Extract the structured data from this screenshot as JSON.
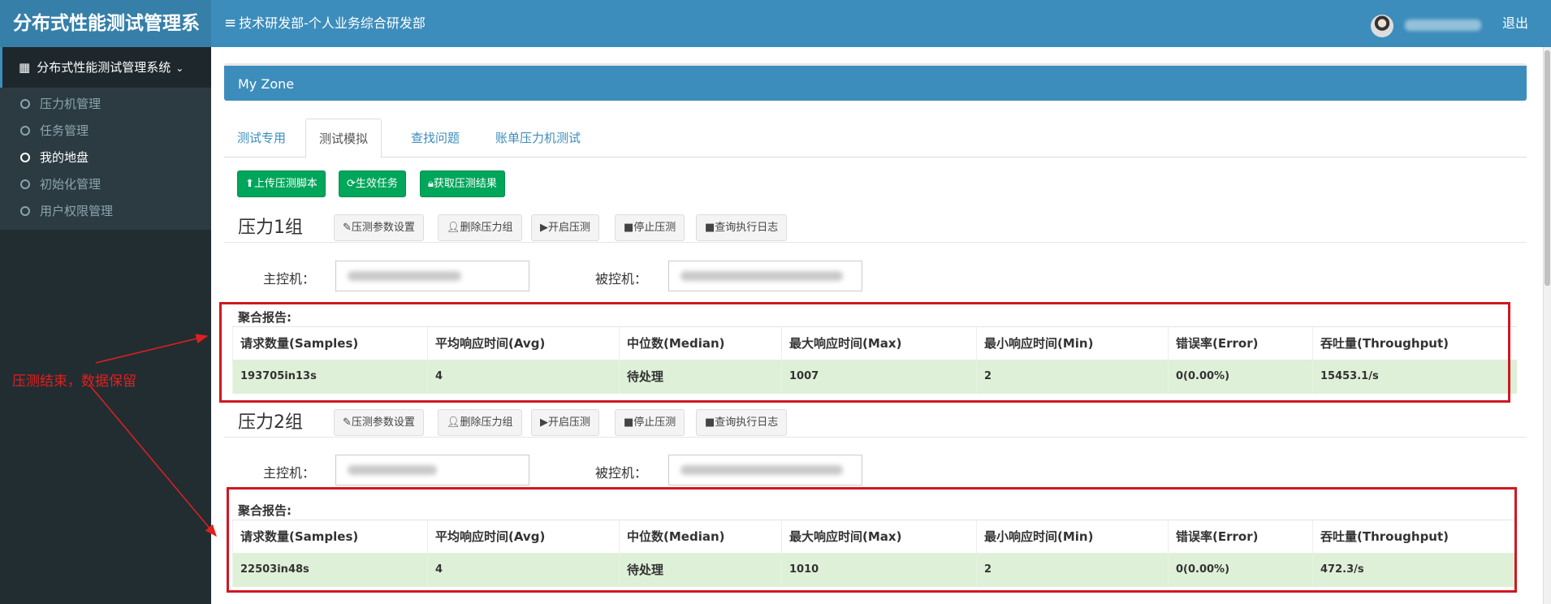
{
  "header": {
    "app_title": "分布式性能测试管理系",
    "department": "技术研发部-个人业务综合研发部",
    "logout_label": "退出"
  },
  "sidebar": {
    "section_label": "分布式性能测试管理系统",
    "items": [
      {
        "label": "压力机管理"
      },
      {
        "label": "任务管理"
      },
      {
        "label": "我的地盘"
      },
      {
        "label": "初始化管理"
      },
      {
        "label": "用户权限管理"
      }
    ],
    "active_index": 2
  },
  "main": {
    "box_title": "My Zone",
    "tabs": [
      {
        "label": "测试专用"
      },
      {
        "label": "测试模拟"
      },
      {
        "label": "查找问题"
      },
      {
        "label": "账单压力机测试"
      }
    ],
    "active_tab": 1,
    "action_buttons": {
      "upload": "上传压测脚本",
      "activate": "生效任务",
      "fetch": "获取压测结果"
    },
    "group_buttons": {
      "params": "压测参数设置",
      "delete": "删除压力组",
      "start": "开启压测",
      "stop": "停止压测",
      "log": "查询执行日志"
    },
    "master_label": "主控机：",
    "slave_label": "被控机：",
    "report_label": "聚合报告:",
    "columns": [
      "请求数量(Samples)",
      "平均响应时间(Avg)",
      "中位数(Median)",
      "最大响应时间(Max)",
      "最小响应时间(Min)",
      "错误率(Error)",
      "吞吐量(Throughput)"
    ],
    "groups": [
      {
        "title": "压力1组",
        "row": [
          "193705in13s",
          "4",
          "待处理",
          "1007",
          "2",
          "0(0.00%)",
          "15453.1/s"
        ]
      },
      {
        "title": "压力2组",
        "row": [
          "22503in48s",
          "4",
          "待处理",
          "1010",
          "2",
          "0(0.00%)",
          "472.3/s"
        ]
      }
    ]
  },
  "annotation": {
    "text": "压测结束，数据保留",
    "color": "#e0201e"
  }
}
